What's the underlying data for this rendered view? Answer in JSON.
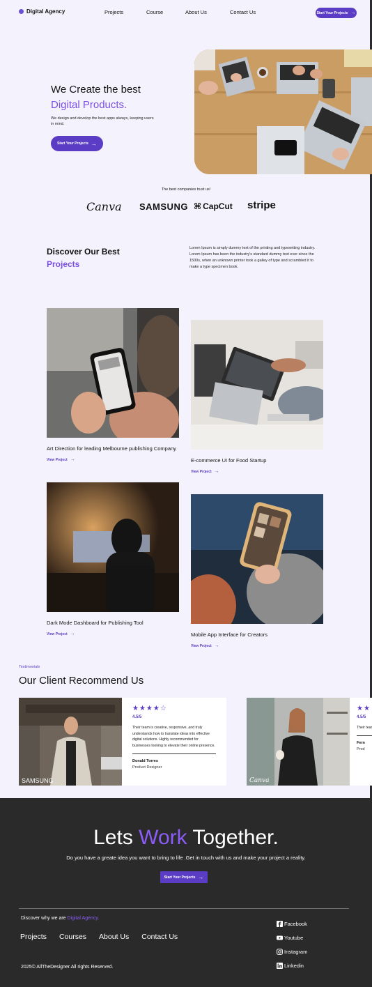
{
  "nav": {
    "brand": "Digital Agency",
    "links": [
      "Projects",
      "Course",
      "About Us",
      "Contact Us"
    ],
    "cta": "Start Your Projects"
  },
  "hero": {
    "title_line1": "We Create the best",
    "title_line2": "Digital Products.",
    "description": "We design and develop the best apps always, keeping users in mind.",
    "cta": "Start Your Projects"
  },
  "trust": {
    "label": "The best companies trust us!",
    "logos": [
      "Canva",
      "SAMSUNG",
      "CapCut",
      "stripe"
    ]
  },
  "discover": {
    "title_line1": "Discover Our Best",
    "title_line2": "Projects",
    "description": "Lorem Ipsum is simply dummy text of the printing and typesetting industry. Lorem Ipsum has been the industry's standard dummy text ever since the 1500s, when an unknown printer took a galley of type and scrambled it to make a type specimen book."
  },
  "projects": [
    {
      "title": "Art Direction for leading Melbourne publishing Company",
      "link": "View Project"
    },
    {
      "title": "E-commerce UI for Food Startup",
      "link": "View Project"
    },
    {
      "title": "Dark Mode Dashboard for Publishing Tool",
      "link": "View Project"
    },
    {
      "title": "Mobile App Interface for Creators",
      "link": "View Project"
    }
  ],
  "testimonials": {
    "label": "Testimonials",
    "title": "Our Client Recommend Us",
    "cards": [
      {
        "rating": "4.5/5",
        "quote": "Their team is creative, responsive, and truly understands how to translate ideas into effective digital solutions. Highly recommended for businesses looking to elevate their online presence.",
        "author": "Donald Torres",
        "role": "Product Designer",
        "logo": "SAMSUNG"
      },
      {
        "rating": "4.5/5",
        "quote": "Their team is creative, responsive, and truly understands how to translate ideas into effective digital solutions. Highly recommended for businesses looking to elevate their online presence.",
        "author": "Fern",
        "role": "Prod",
        "logo": "Canva"
      }
    ]
  },
  "footer": {
    "heading_pre": "Lets ",
    "heading_accent": "Work",
    "heading_post": " Together.",
    "subtitle": "Do you have a greate idea you want to bring to life .Get in touch with us and make your project a reality.",
    "cta": "Start Your Projects",
    "why_pre": "Discover why we are ",
    "why_accent": "Digital Agency.",
    "links": [
      "Projects",
      "Courses",
      "About Us",
      "Contact Us"
    ],
    "copyright": "2025© AllTheDesigner.All rights Reserved.",
    "social": [
      "Facebook",
      "Youtube",
      "Instagram",
      "Linkedin"
    ]
  },
  "colors": {
    "accent": "#5b3cc4",
    "accent_light": "#7b4fe0",
    "footer_bg": "#2a2a2a",
    "page_bg": "#f4f3fd"
  }
}
